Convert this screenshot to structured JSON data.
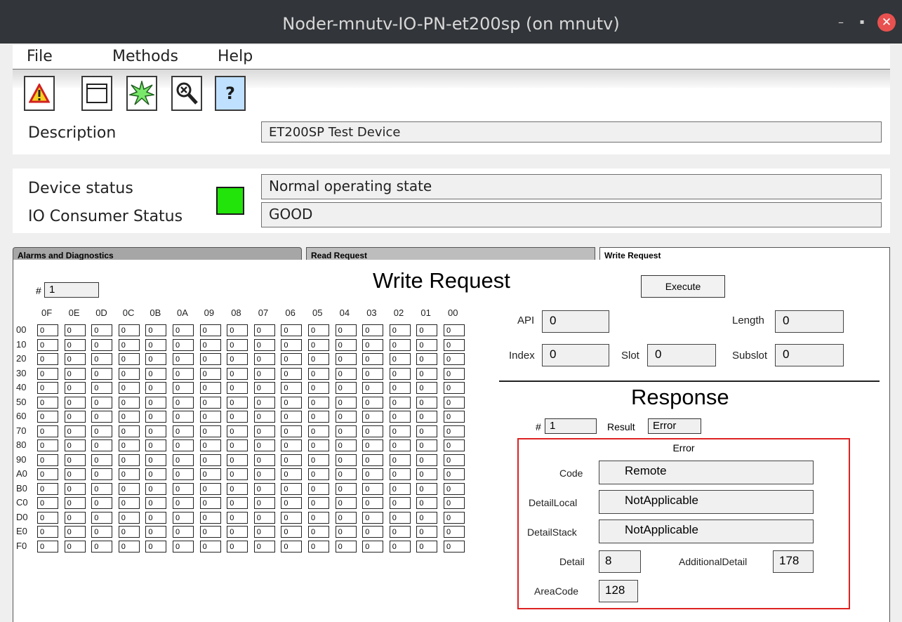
{
  "window": {
    "title": "Noder-mnutv-IO-PN-et200sp (on mnutv)",
    "minimize": "–",
    "restore": "▪",
    "close": "✕"
  },
  "menu": [
    "File",
    "Methods",
    "Help"
  ],
  "description": {
    "label": "Description",
    "value": "ET200SP Test Device"
  },
  "device_status": {
    "label": "Device status",
    "value": "Normal operating state"
  },
  "consumer_status": {
    "label": "IO Consumer Status",
    "value": "GOOD"
  },
  "status_color": "#22e30a",
  "tabs": [
    "Alarms and Diagnostics",
    "Read Request",
    "Write Request"
  ],
  "write": {
    "heading": "Write Request",
    "hash_label": "#",
    "hash_value": "1",
    "execute": "Execute",
    "col_headers": [
      "0F",
      "0E",
      "0D",
      "0C",
      "0B",
      "0A",
      "09",
      "08",
      "07",
      "06",
      "05",
      "04",
      "03",
      "02",
      "01",
      "00"
    ],
    "row_headers": [
      "00",
      "10",
      "20",
      "30",
      "40",
      "50",
      "60",
      "70",
      "80",
      "90",
      "A0",
      "B0",
      "C0",
      "D0",
      "E0",
      "F0"
    ],
    "cell_value": "0",
    "api_label": "API",
    "api": "0",
    "length_label": "Length",
    "length": "0",
    "index_label": "Index",
    "index": "0",
    "slot_label": "Slot",
    "slot": "0",
    "subslot_label": "Subslot",
    "subslot": "0"
  },
  "response": {
    "heading": "Response",
    "hash_label": "#",
    "hash_value": "1",
    "result_label": "Result",
    "result": "Error",
    "error_title": "Error",
    "code_label": "Code",
    "code": "Remote",
    "detail_local_label": "DetailLocal",
    "detail_local": "NotApplicable",
    "detail_stack_label": "DetailStack",
    "detail_stack": "NotApplicable",
    "detail_label": "Detail",
    "detail": "8",
    "additional_label": "AdditionalDetail",
    "additional": "178",
    "area_label": "AreaCode",
    "area": "128"
  }
}
